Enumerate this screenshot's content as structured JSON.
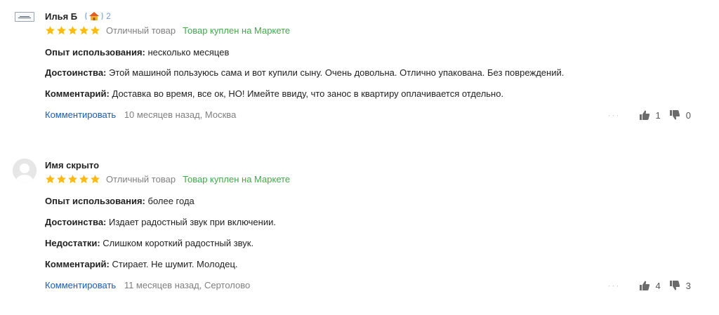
{
  "reviews": [
    {
      "author": "Илья Б",
      "badge_count": "2",
      "rating": 5,
      "rating_text": "Отличный товар",
      "bought_label": "Товар куплен на Маркете",
      "fields": [
        {
          "label": "Опыт использования:",
          "value": "несколько месяцев"
        },
        {
          "label": "Достоинства:",
          "value": "Этой машиной пользуюсь сама и вот купили сыну. Очень довольна. Отлично упакована. Без повреждений."
        },
        {
          "label": "Комментарий:",
          "value": "Доставка во время, все ок, НО! Имейте ввиду, что занос в квартиру оплачивается отдельно."
        }
      ],
      "comment_link": "Комментировать",
      "meta": "10 месяцев назад, Москва",
      "likes": "1",
      "dislikes": "0"
    },
    {
      "author": "Имя скрыто",
      "rating": 5,
      "rating_text": "Отличный товар",
      "bought_label": "Товар куплен на Маркете",
      "fields": [
        {
          "label": "Опыт использования:",
          "value": "более года"
        },
        {
          "label": "Достоинства:",
          "value": "Издает радостный звук при включении."
        },
        {
          "label": "Недостатки:",
          "value": "Слишком короткий радостный звук."
        },
        {
          "label": "Комментарий:",
          "value": "Стирает. Не шумит. Молодец."
        }
      ],
      "comment_link": "Комментировать",
      "meta": "11 месяцев назад, Сертолово",
      "likes": "4",
      "dislikes": "3"
    }
  ],
  "colors": {
    "star": "#fdb913",
    "bought": "#43a84a",
    "link": "#1a5bb6",
    "muted": "#7f7f7f",
    "thumb": "#6b6b6b"
  },
  "icons": {
    "star": "star-icon",
    "like": "thumb-up-icon",
    "dislike": "thumb-down-icon",
    "more": "more-dots-icon",
    "badge": "house-badge-icon"
  }
}
